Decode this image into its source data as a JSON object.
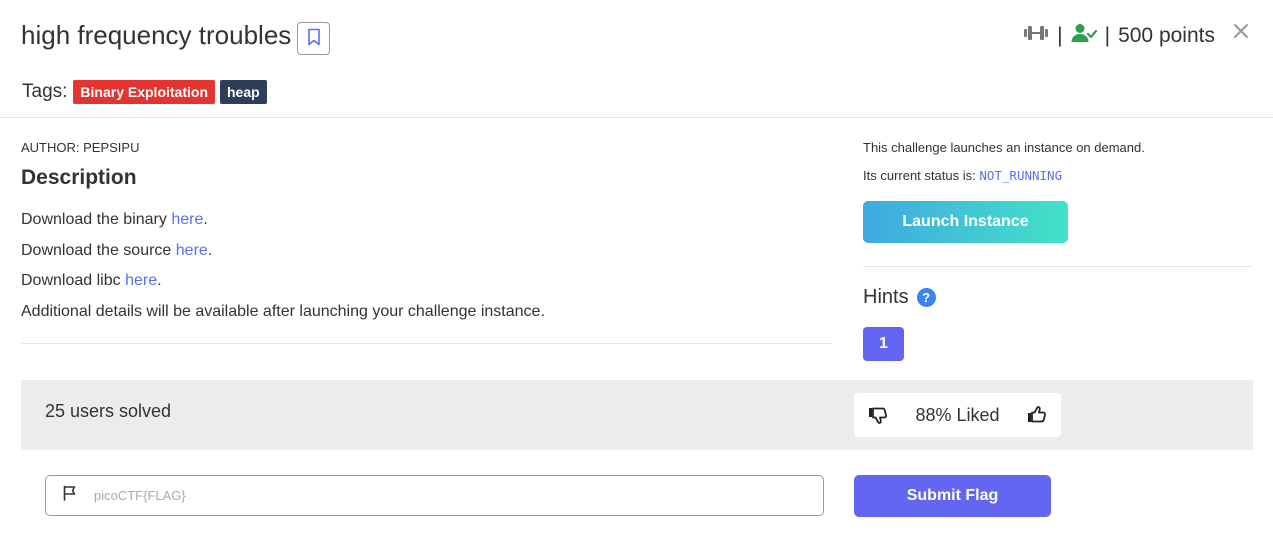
{
  "challenge": {
    "title": "high frequency troubles",
    "points": "500 points",
    "icons": {
      "bookmark": "bookmark-icon",
      "difficulty": "dumbbell-icon",
      "solved": "user-check-icon",
      "close": "close-icon"
    }
  },
  "tags": {
    "label": "Tags:",
    "items": [
      {
        "label": "Binary Exploitation",
        "color": "#e3342f"
      },
      {
        "label": "heap",
        "color": "#2c3e5a"
      }
    ]
  },
  "description": {
    "author": "AUTHOR: PEPSIPU",
    "heading": "Description",
    "lines": [
      {
        "text": "Download the binary ",
        "link": "here",
        "suffix": "."
      },
      {
        "text": "Download the source ",
        "link": "here",
        "suffix": "."
      },
      {
        "text": "Download libc ",
        "link": "here",
        "suffix": "."
      },
      {
        "text": "Additional details will be available after launching your challenge instance.",
        "link": "",
        "suffix": ""
      }
    ]
  },
  "instance": {
    "info": "This challenge launches an instance on demand.",
    "status_label": "Its current status is: ",
    "status_value": "NOT_RUNNING",
    "launch_label": "Launch Instance"
  },
  "hints": {
    "heading": "Hints",
    "help_icon": "?",
    "items": [
      "1"
    ]
  },
  "stats": {
    "solved": "25 users solved",
    "liked": "88% Liked"
  },
  "flag": {
    "placeholder": "picoCTF{FLAG}",
    "value": "",
    "submit_label": "Submit Flag"
  },
  "colors": {
    "accent": "#6366f1",
    "link": "#5a6ff0",
    "success": "#2e9e4f",
    "launch_gradient": [
      "#3fa9e0",
      "#43e2c8"
    ]
  }
}
